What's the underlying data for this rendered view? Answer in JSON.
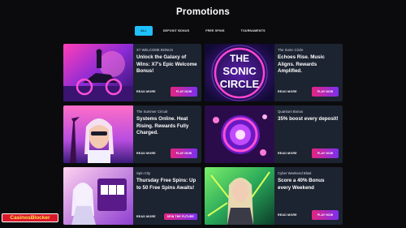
{
  "page": {
    "title": "Promotions"
  },
  "tabs": [
    "ALL",
    "DEPOSIT BONUS",
    "FREE SPINS",
    "TOURNAMENTS"
  ],
  "cards": [
    {
      "tag": "X7 WELCOME BONUS",
      "headline": "Unlock the Galaxy of Wins: X7's Epic Welcome Bonus!",
      "more": "READ MORE",
      "cta": "PLAY NOW"
    },
    {
      "tag": "The Sonic Circle",
      "headline": "Echoes Rise. Music Aligns. Rewards Amplified.",
      "more": "READ MORE",
      "cta": "PLAY NOW",
      "image_text": [
        "THE",
        "SONIC",
        "CIRCLE"
      ]
    },
    {
      "tag": "The Summer Circuit",
      "headline": "Systems Online. Heat Rising. Rewards Fully Charged.",
      "more": "READ MORE",
      "cta": "PLAY NOW"
    },
    {
      "tag": "Quantum Bonus",
      "headline": "35% boost every deposit!",
      "more": "READ MORE",
      "cta": "PLAY NOW"
    },
    {
      "tag": "Spin City",
      "headline": "Thursday Free Spins: Up to 50 Free Spins Awaits!",
      "more": "READ MORE",
      "cta": "SPIN THE FUTURE"
    },
    {
      "tag": "Cyber Weekend Blast",
      "headline": "Score a 40% Bonus every Weekend",
      "more": "READ MORE",
      "cta": "PLAY NOW"
    }
  ],
  "watermark": {
    "text": "CasinosBlocker"
  }
}
